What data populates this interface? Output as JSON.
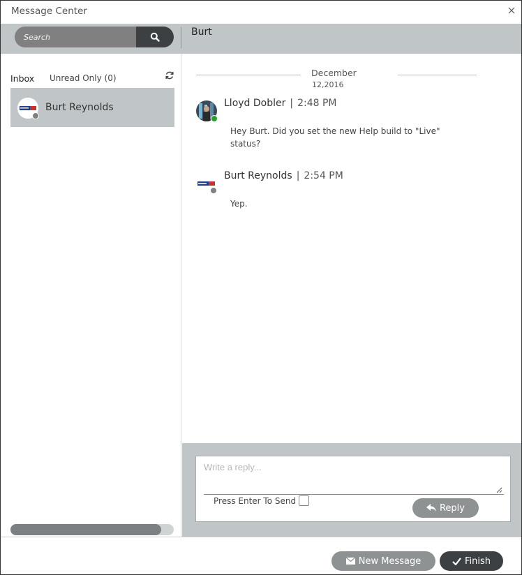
{
  "window": {
    "title": "Message Center"
  },
  "search": {
    "placeholder": "Search"
  },
  "conversation": {
    "name": "Burt"
  },
  "sidebar": {
    "inbox_label": "Inbox",
    "unread_label": "Unread Only (0)",
    "contacts": [
      {
        "name": "Burt Reynolds",
        "status_color": "#808080"
      }
    ]
  },
  "chat": {
    "date_month": "December",
    "date_day": "12,2016",
    "messages": [
      {
        "sender": "Lloyd Dobler",
        "time": "2:48 PM",
        "text": "Hey Burt. Did you set the new Help build to \"Live\" status?",
        "status_color": "#2aa02a"
      },
      {
        "sender": "Burt Reynolds",
        "time": "2:54 PM",
        "text": "Yep.",
        "status_color": "#808080"
      }
    ]
  },
  "compose": {
    "placeholder": "Write a reply...",
    "enter_to_send_label": "Press Enter To Send",
    "reply_label": "Reply"
  },
  "footer": {
    "new_message_label": "New Message",
    "finish_label": "Finish"
  },
  "colors": {
    "panel_gray": "#c0c6c8",
    "button_gray": "#8f9293",
    "button_dark": "#3d4042"
  },
  "icons": [
    "close-icon",
    "search-icon",
    "refresh-icon",
    "reply-arrow-icon",
    "envelope-icon",
    "checkmark-icon"
  ]
}
